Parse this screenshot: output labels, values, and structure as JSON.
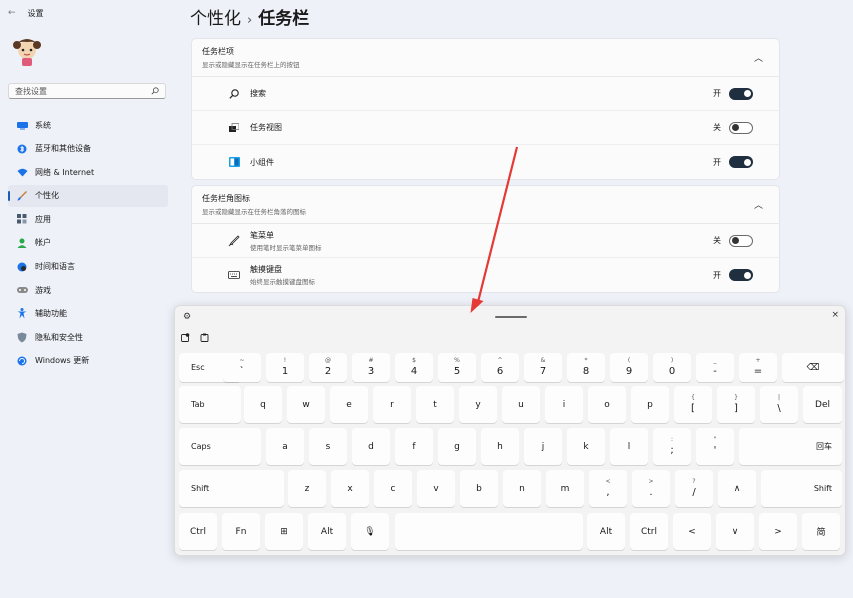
{
  "window": {
    "back_glyph": "←",
    "title": "设置"
  },
  "search": {
    "placeholder": "查找设置",
    "icon": "search-icon"
  },
  "sidebar": {
    "items": [
      {
        "label": "系统",
        "icon": "monitor-icon",
        "color": "#1a73e8"
      },
      {
        "label": "蓝牙和其他设备",
        "icon": "bluetooth-icon",
        "color": "#1a73e8"
      },
      {
        "label": "网络 & Internet",
        "icon": "wifi-icon",
        "color": "#1a73e8"
      },
      {
        "label": "个性化",
        "icon": "brush-icon",
        "color": "#c87f3a",
        "active": true
      },
      {
        "label": "应用",
        "icon": "apps-icon",
        "color": "#4a5a6e"
      },
      {
        "label": "帐户",
        "icon": "account-icon",
        "color": "#2aa84a"
      },
      {
        "label": "时间和语言",
        "icon": "globe-clock-icon",
        "color": "#1a73e8"
      },
      {
        "label": "游戏",
        "icon": "gamepad-icon",
        "color": "#6a6a6a"
      },
      {
        "label": "辅助功能",
        "icon": "accessibility-icon",
        "color": "#1a73e8"
      },
      {
        "label": "隐私和安全性",
        "icon": "shield-icon",
        "color": "#6a7a8a"
      },
      {
        "label": "Windows 更新",
        "icon": "update-icon",
        "color": "#1a73e8"
      }
    ]
  },
  "header": {
    "crumb1": "个性化",
    "sep": "›",
    "crumb2": "任务栏"
  },
  "section_taskbar_items": {
    "title": "任务栏项",
    "subtitle": "显示或隐藏显示在任务栏上的按钮",
    "rows": [
      {
        "label": "搜索",
        "state": "开",
        "on": true,
        "icon": "search-icon"
      },
      {
        "label": "任务视图",
        "state": "关",
        "on": false,
        "icon": "task-view-icon"
      },
      {
        "label": "小组件",
        "state": "开",
        "on": true,
        "icon": "widgets-icon"
      }
    ]
  },
  "section_corner_icons": {
    "title": "任务栏角图标",
    "subtitle": "显示或隐藏显示在任务栏角落的图标",
    "rows": [
      {
        "label": "笔菜单",
        "sub": "使用笔时显示笔菜单图标",
        "state": "关",
        "on": false,
        "icon": "pen-icon"
      },
      {
        "label": "触摸键盘",
        "sub": "始终显示触摸键盘图标",
        "state": "开",
        "on": true,
        "icon": "keyboard-icon"
      }
    ]
  },
  "keyboard": {
    "gear_icon": "gear-icon",
    "close_glyph": "×",
    "row1": [
      {
        "main": "Esc",
        "mod": true
      },
      {
        "shift": "~",
        "main": "`"
      },
      {
        "shift": "!",
        "main": "1"
      },
      {
        "shift": "@",
        "main": "2"
      },
      {
        "shift": "#",
        "main": "3"
      },
      {
        "shift": "$",
        "main": "4"
      },
      {
        "shift": "%",
        "main": "5"
      },
      {
        "shift": "^",
        "main": "6"
      },
      {
        "shift": "&",
        "main": "7"
      },
      {
        "shift": "*",
        "main": "8"
      },
      {
        "shift": "(",
        "main": "9"
      },
      {
        "shift": ")",
        "main": "0"
      },
      {
        "shift": "_",
        "main": "-"
      },
      {
        "shift": "+",
        "main": "="
      },
      {
        "main": "⌫",
        "icon": "backspace-icon"
      }
    ],
    "row2": [
      {
        "main": "Tab",
        "mod": true
      },
      {
        "main": "q"
      },
      {
        "main": "w"
      },
      {
        "main": "e"
      },
      {
        "main": "r"
      },
      {
        "main": "t"
      },
      {
        "main": "y"
      },
      {
        "main": "u"
      },
      {
        "main": "i"
      },
      {
        "main": "o"
      },
      {
        "main": "p"
      },
      {
        "shift": "{",
        "main": "["
      },
      {
        "shift": "}",
        "main": "]"
      },
      {
        "shift": "|",
        "main": "\\"
      },
      {
        "main": "Del"
      }
    ],
    "row3": [
      {
        "main": "Caps",
        "mod": true
      },
      {
        "main": "a"
      },
      {
        "main": "s"
      },
      {
        "main": "d"
      },
      {
        "main": "f"
      },
      {
        "main": "g"
      },
      {
        "main": "h"
      },
      {
        "main": "j"
      },
      {
        "main": "k"
      },
      {
        "main": "l"
      },
      {
        "shift": ":",
        "main": ";"
      },
      {
        "shift": "\"",
        "main": "'"
      },
      {
        "main": "回车",
        "modr": true
      }
    ],
    "row4": [
      {
        "main": "Shift",
        "mod": true
      },
      {
        "main": "z"
      },
      {
        "main": "x"
      },
      {
        "main": "c"
      },
      {
        "main": "v"
      },
      {
        "main": "b"
      },
      {
        "main": "n"
      },
      {
        "main": "m"
      },
      {
        "shift": "<",
        "main": ","
      },
      {
        "shift": ">",
        "main": "."
      },
      {
        "shift": "?",
        "main": "/"
      },
      {
        "main": "∧",
        "icon": "arrow-up-icon"
      },
      {
        "main": "Shift",
        "modr": true
      }
    ],
    "row5": [
      {
        "main": "Ctrl"
      },
      {
        "main": "Fn"
      },
      {
        "main": "⊞",
        "icon": "windows-icon"
      },
      {
        "main": "Alt"
      },
      {
        "main": "🎙",
        "icon": "microphone-icon"
      },
      {
        "main": ""
      },
      {
        "main": "Alt"
      },
      {
        "main": "Ctrl"
      },
      {
        "main": "<",
        "icon": "arrow-left-icon"
      },
      {
        "main": "∨",
        "icon": "arrow-down-icon"
      },
      {
        "main": ">",
        "icon": "arrow-right-icon"
      },
      {
        "main": "简",
        "icon": "ime-mode-icon"
      }
    ]
  },
  "colors": {
    "accent": "#1a5fb4",
    "arrow": "#e53935",
    "toggle_on": "#1f2f3f"
  }
}
